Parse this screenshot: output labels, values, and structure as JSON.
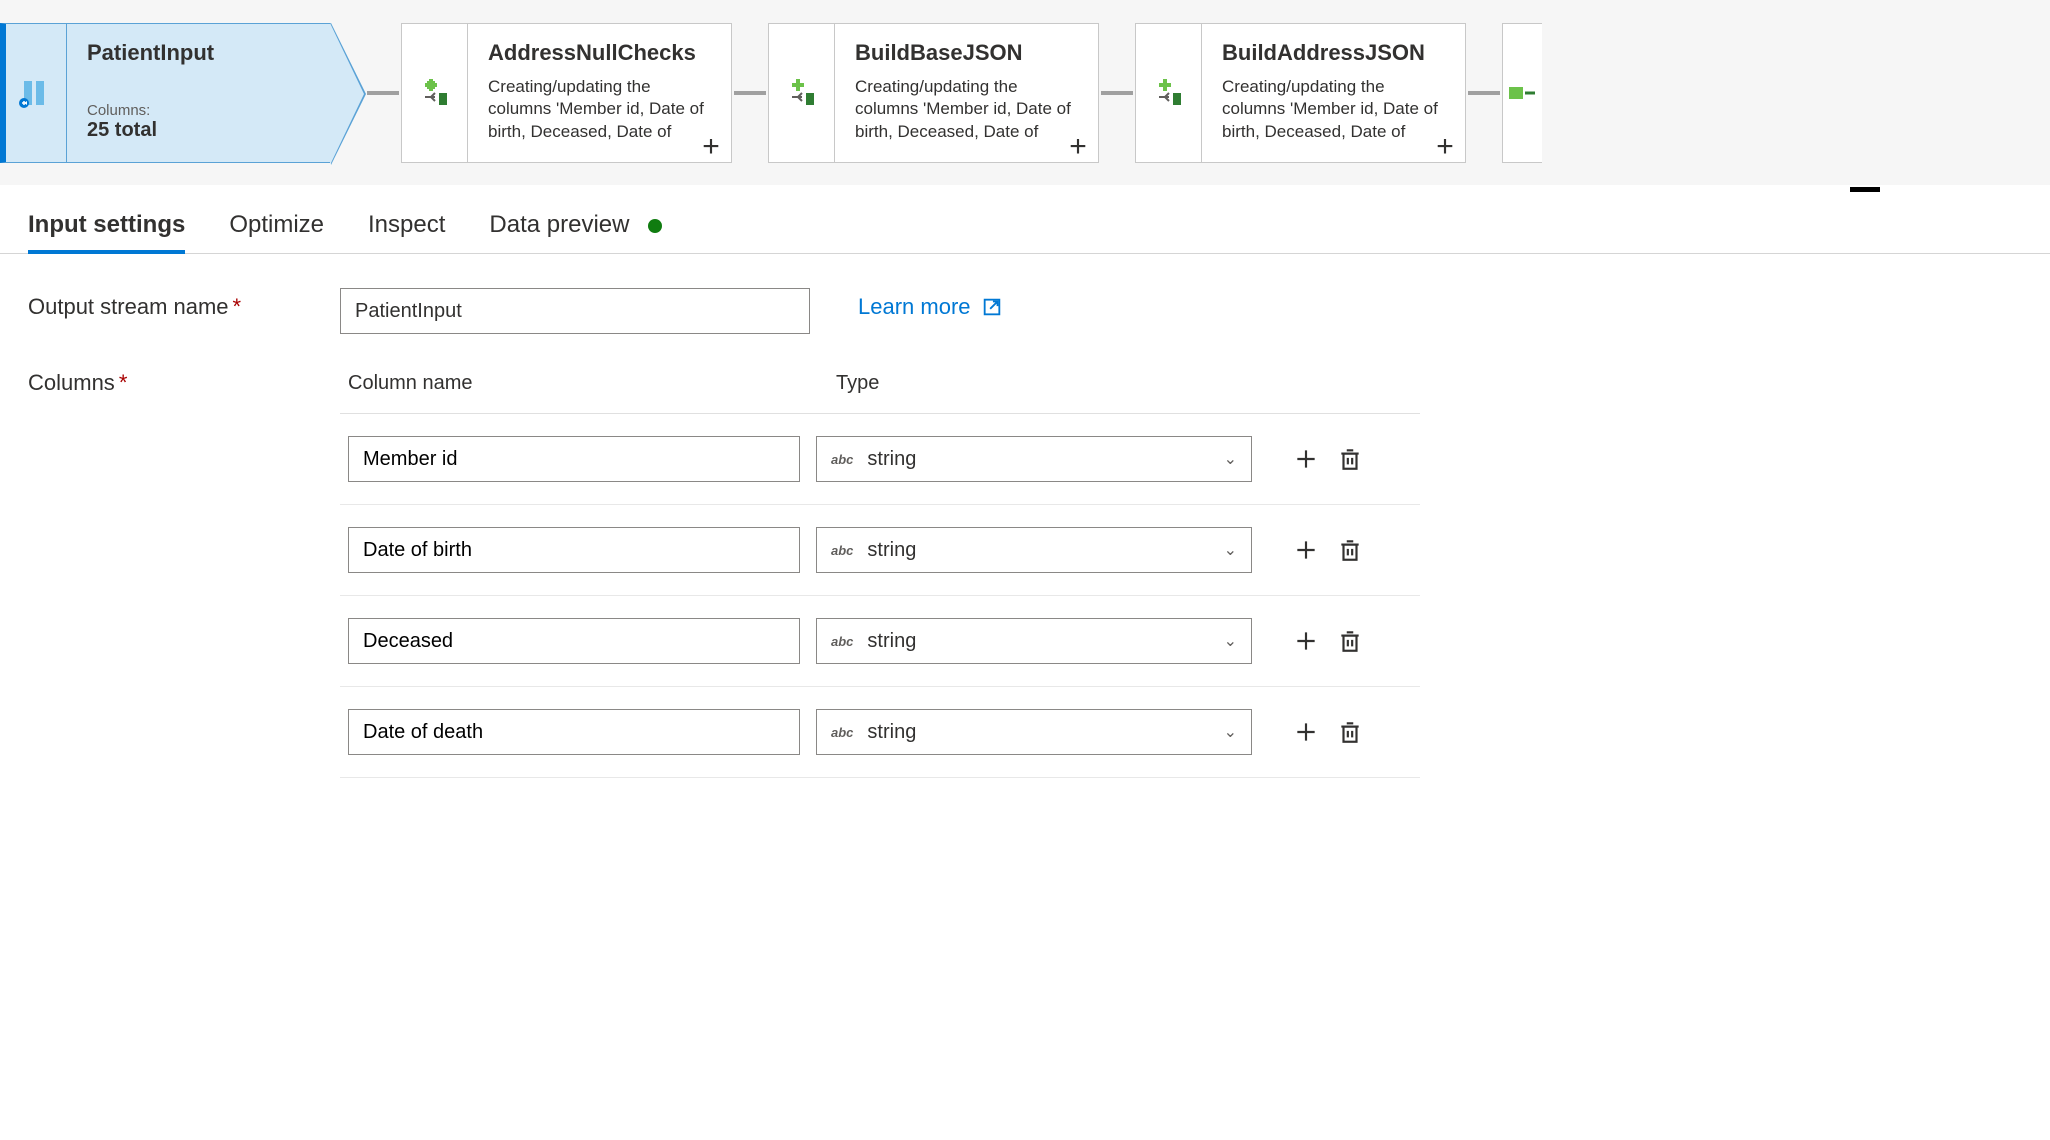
{
  "flow": {
    "selected": {
      "title": "PatientInput",
      "meta_label": "Columns:",
      "meta_value": "25 total"
    },
    "nodes": [
      {
        "title": "AddressNullChecks",
        "desc": "Creating/updating the columns 'Member id, Date of birth, Deceased, Date of death, Home street address,"
      },
      {
        "title": "BuildBaseJSON",
        "desc": "Creating/updating the columns 'Member id, Date of birth, Deceased, Date of death, Home street address,"
      },
      {
        "title": "BuildAddressJSON",
        "desc": "Creating/updating the columns 'Member id, Date of birth, Deceased, Date of death, Home street address,"
      }
    ]
  },
  "tabs": {
    "t0": "Input settings",
    "t1": "Optimize",
    "t2": "Inspect",
    "t3": "Data preview"
  },
  "form": {
    "output_stream_label": "Output stream name",
    "output_stream_value": "PatientInput",
    "learn_more": "Learn more",
    "columns_label": "Columns",
    "column_name_header": "Column name",
    "column_type_header": "Type",
    "type_prefix": "abc",
    "rows": [
      {
        "name": "Member id",
        "type": "string"
      },
      {
        "name": "Date of birth",
        "type": "string"
      },
      {
        "name": "Deceased",
        "type": "string"
      },
      {
        "name": "Date of death",
        "type": "string"
      }
    ]
  }
}
